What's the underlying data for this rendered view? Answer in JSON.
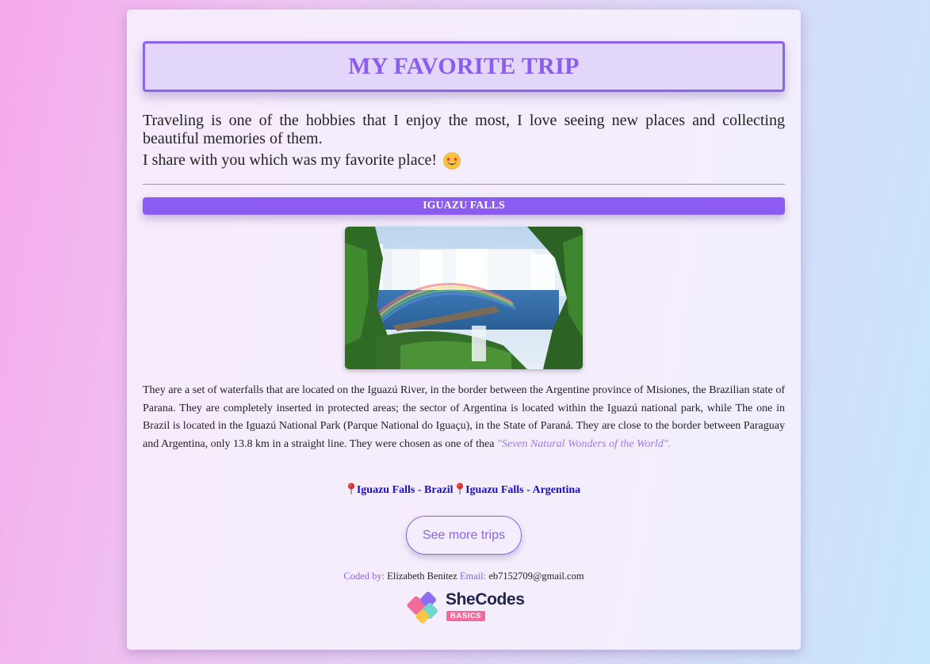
{
  "header": {
    "title": "MY FAVORITE TRIP"
  },
  "intro": {
    "paragraph": "Traveling is one of the hobbies that I enjoy the most, I love seeing new places and collecting beautiful memories of them.",
    "share_line": "I share with you which was my favorite place!",
    "emoji": "star-struck-emoji"
  },
  "section": {
    "title": "IGUAZU FALLS",
    "photo_icon": "waterfall-photo",
    "description": "They are a set of waterfalls that are located on the Iguazú River, in the border between the Argentine province of Misiones, the Brazilian state of Parana. They are completely inserted in protected areas; the sector of Argentina is located within the Iguazú national park, while The one in Brazil is located in the Iguazú National Park (Parque National do Iguaçu), in the State of Paraná. They are close to the border between Paraguay and Argentina, only 13.8 km in a straight line. They were chosen as one of thea",
    "quote": "\"Seven Natural Wonders of the World\"."
  },
  "links": {
    "brazil_label": "Iguazu Falls - Brazil",
    "argentina_label": "Iguazu Falls - Argentina",
    "pin_icon": "round-pushpin-icon"
  },
  "button": {
    "label": "See more trips"
  },
  "footer": {
    "coded_by_label": "Coded by:",
    "author": "Elizabeth Benitez",
    "email_label": "Email:",
    "email": "eb7152709@gmail.com"
  },
  "logo": {
    "word": "SheCodes",
    "badge": "BASICS"
  },
  "colors": {
    "accent": "#8c5cf2",
    "link": "#1a0dcc",
    "quote": "#9b7bea"
  }
}
